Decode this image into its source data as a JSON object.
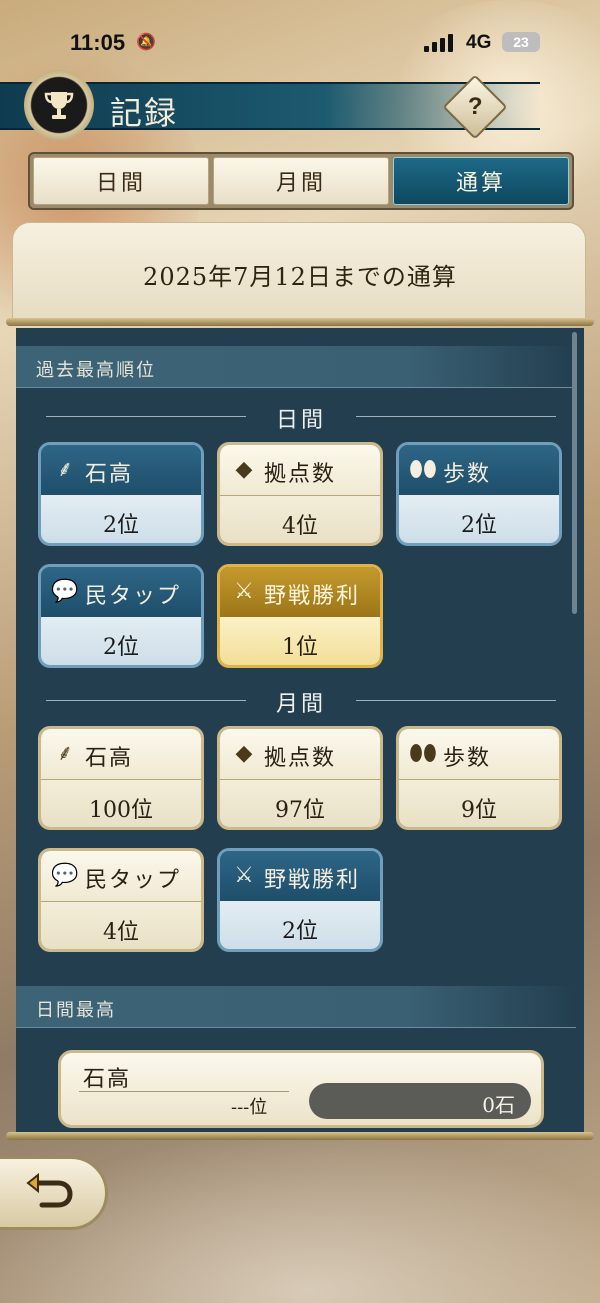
{
  "status_bar": {
    "time": "11:05",
    "network": "4G",
    "battery": "23"
  },
  "header": {
    "title": "記録",
    "help_label": "?"
  },
  "tabs": [
    {
      "label": "日間",
      "active": false
    },
    {
      "label": "月間",
      "active": false
    },
    {
      "label": "通算",
      "active": true
    }
  ],
  "panel": {
    "title": "2025年7月12日までの通算"
  },
  "best_rank_section": {
    "title": "過去最高順位",
    "daily": {
      "label": "日間",
      "cards": [
        {
          "icon": "rice-icon",
          "name": "石高",
          "rank": "2位",
          "style": "blue"
        },
        {
          "icon": "diamond-icon",
          "name": "拠点数",
          "rank": "4位",
          "style": "cream"
        },
        {
          "icon": "footprints-icon",
          "name": "歩数",
          "rank": "2位",
          "style": "blue"
        },
        {
          "icon": "speech-bubble-icon",
          "name": "民タップ",
          "rank": "2位",
          "style": "blue"
        },
        {
          "icon": "crossed-swords-icon",
          "name": "野戦勝利",
          "rank": "1位",
          "style": "gold"
        }
      ]
    },
    "monthly": {
      "label": "月間",
      "cards": [
        {
          "icon": "rice-icon",
          "name": "石高",
          "rank": "100位",
          "style": "cream"
        },
        {
          "icon": "diamond-icon",
          "name": "拠点数",
          "rank": "97位",
          "style": "cream"
        },
        {
          "icon": "footprints-icon",
          "name": "歩数",
          "rank": "9位",
          "style": "cream"
        },
        {
          "icon": "speech-bubble-icon",
          "name": "民タップ",
          "rank": "4位",
          "style": "cream"
        },
        {
          "icon": "crossed-swords-icon",
          "name": "野戦勝利",
          "rank": "2位",
          "style": "blue"
        }
      ]
    }
  },
  "daily_best_section": {
    "title": "日間最高",
    "item": {
      "name": "石高",
      "rank": "---位",
      "value": "0石"
    }
  },
  "footer": {
    "back_icon": "back-arrow-icon"
  }
}
